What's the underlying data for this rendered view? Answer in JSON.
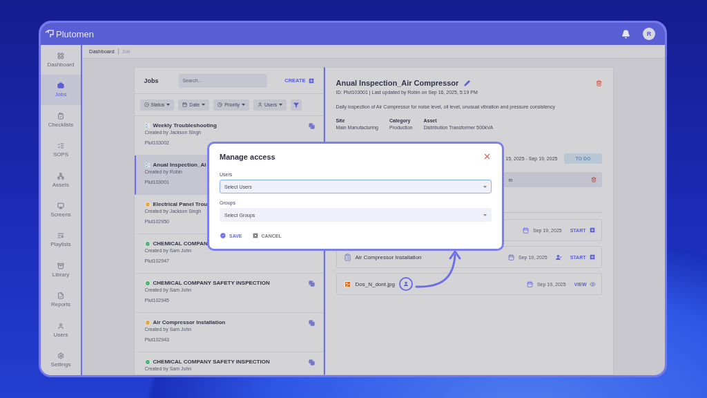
{
  "app": {
    "logo": "Plutomen",
    "avatar": "R"
  },
  "sidebar": {
    "items": [
      {
        "label": "Dashboard",
        "selected": false
      },
      {
        "label": "Jobs",
        "selected": true
      },
      {
        "label": "Checklists",
        "selected": false
      },
      {
        "label": "SOPS",
        "selected": false
      },
      {
        "label": "Assets",
        "selected": false
      },
      {
        "label": "Screens",
        "selected": false
      },
      {
        "label": "Playlists",
        "selected": false
      },
      {
        "label": "Library",
        "selected": false
      },
      {
        "label": "Reports",
        "selected": false
      },
      {
        "label": "Users",
        "selected": false
      },
      {
        "label": "Settings",
        "selected": false
      }
    ]
  },
  "breadcrumb": [
    "Dashboard",
    "Job"
  ],
  "jobs": {
    "title": "Jobs",
    "search": {
      "placeholder": "Search..."
    },
    "create": "CREATE",
    "filters": [
      "Status",
      "Date",
      "Priority",
      "Users"
    ],
    "items": [
      {
        "title": "Weekly Troubleshooting",
        "creator": "Created by Jackson Singh",
        "id": "Plut103002",
        "kind": "board",
        "selected": false,
        "copy": true
      },
      {
        "title": "Anual Inspection_Ai",
        "creator": "Created by Robin",
        "id": "Plut103001",
        "kind": "board",
        "selected": true,
        "copy": false
      },
      {
        "title": "Electrical Panel Trou",
        "creator": "Created by Jackson Singh",
        "id": "Plut102950",
        "kind": "progress",
        "selected": false,
        "copy": false
      },
      {
        "title": "CHEMICAL COMPAN",
        "creator": "Created by Sam John",
        "id": "Plut102947",
        "kind": "done",
        "selected": false,
        "copy": false
      },
      {
        "title": "CHEMICAL COMPANY SAFETY INSPECTION",
        "creator": "Created by Sam John",
        "id": "Plut102945",
        "kind": "done",
        "selected": false,
        "copy": true
      },
      {
        "title": "Air Compressor Installation",
        "creator": "Created by Sam John",
        "id": "Plut102943",
        "kind": "progress",
        "selected": false,
        "copy": true
      },
      {
        "title": "CHEMICAL COMPANY SAFETY INSPECTION",
        "creator": "Created by Sam John",
        "kind": "done",
        "selected": false,
        "copy": true
      }
    ]
  },
  "detail": {
    "title": "Anual Inspection_Air Compressor",
    "meta": "ID: Plut103001 | Last updated by Robin on Sep 16, 2025, 5:19 PM",
    "description": "Daily inspection of Air Compressor for noise level, oil level, unusual vibration and pressure consistency",
    "fields": [
      {
        "label": "Site",
        "value": "Main Manufacturing"
      },
      {
        "label": "Category",
        "value": "Production"
      },
      {
        "label": "Asset",
        "value": "Distribution Transformer 500kVA"
      }
    ],
    "schedule": "15, 2025 - Sep 19, 2025",
    "status": "TO DO",
    "assignee": "m",
    "attachments": [
      {
        "kind": "task",
        "name_assign": false,
        "date_assign": false,
        "date": "Sep 19, 2025",
        "action": "START"
      },
      {
        "kind": "task",
        "name": "Air Compressor Installation",
        "name_assign": false,
        "date_assign": true,
        "date": "Sep 19, 2025",
        "action": "START"
      },
      {
        "kind": "file",
        "name": "Dos_N_dont.jpg",
        "name_assign": true,
        "date_assign": false,
        "date": "Sep 19, 2025",
        "action": "VIEW"
      }
    ]
  },
  "modal": {
    "title": "Manage access",
    "fields": [
      {
        "label": "Users",
        "placeholder": "Select Users",
        "focused": true
      },
      {
        "label": "Groups",
        "placeholder": "Select Groups",
        "focused": false
      }
    ],
    "save": "SAVE",
    "cancel": "CANCEL"
  }
}
